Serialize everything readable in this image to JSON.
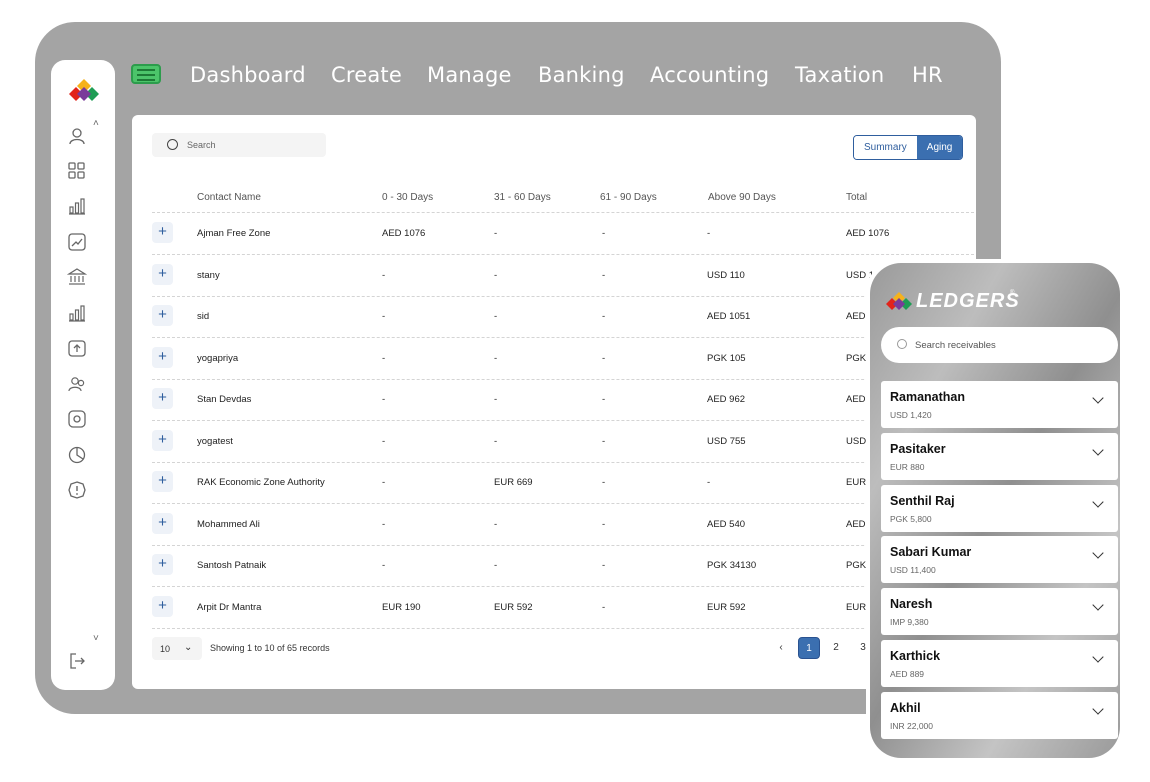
{
  "nav": {
    "items": [
      "Dashboard",
      "Create",
      "Manage",
      "Banking",
      "Accounting",
      "Taxation",
      "HR"
    ]
  },
  "sidebar": {
    "icons": [
      "user-icon",
      "grid-icon",
      "bar-chart-icon",
      "trend-chart-icon",
      "bank-icon",
      "bar-chart-icon",
      "upload-icon",
      "users-icon",
      "settings-icon",
      "pie-chart-icon",
      "alert-icon"
    ],
    "logout_icon": "logout-icon"
  },
  "panel": {
    "search_placeholder": "Search",
    "toggle": {
      "summary": "Summary",
      "aging": "Aging"
    },
    "columns": [
      "Contact Name",
      "0 - 30 Days",
      "31 - 60 Days",
      "61 - 90 Days",
      "Above 90 Days",
      "Total"
    ],
    "rows": [
      {
        "name": "Ajman Free Zone",
        "d0": "AED 1076",
        "d31": "-",
        "d61": "-",
        "d90": "-",
        "total": "AED 1076"
      },
      {
        "name": "stany",
        "d0": "-",
        "d31": "-",
        "d61": "-",
        "d90": "USD 110",
        "total": "USD 1"
      },
      {
        "name": "sid",
        "d0": "-",
        "d31": "-",
        "d61": "-",
        "d90": "AED 1051",
        "total": "AED"
      },
      {
        "name": "yogapriya",
        "d0": "-",
        "d31": "-",
        "d61": "-",
        "d90": "PGK 105",
        "total": "PGK"
      },
      {
        "name": "Stan Devdas",
        "d0": "-",
        "d31": "-",
        "d61": "-",
        "d90": "AED 962",
        "total": "AED"
      },
      {
        "name": "yogatest",
        "d0": "-",
        "d31": "-",
        "d61": "-",
        "d90": "USD 755",
        "total": "USD"
      },
      {
        "name": "RAK Economic Zone Authority",
        "d0": "-",
        "d31": "EUR 669",
        "d61": "-",
        "d90": "-",
        "total": "EUR"
      },
      {
        "name": "Mohammed Ali",
        "d0": "-",
        "d31": "-",
        "d61": "-",
        "d90": "AED 540",
        "total": "AED"
      },
      {
        "name": "Santosh Patnaik",
        "d0": "-",
        "d31": "-",
        "d61": "-",
        "d90": "PGK 34130",
        "total": "PGK"
      },
      {
        "name": "Arpit Dr Mantra",
        "d0": "EUR 190",
        "d31": "EUR 592",
        "d61": "-",
        "d90": "EUR 592",
        "total": "EUR"
      }
    ],
    "page_size": "10",
    "showing": "Showing 1 to 10 of 65 records",
    "pages": [
      "1",
      "2",
      "3"
    ],
    "prev": "‹"
  },
  "phone": {
    "brand": "LEDGERS",
    "reg": "®",
    "search_placeholder": "Search receivables",
    "cards": [
      {
        "name": "Ramanathan",
        "amount": "USD 1,420"
      },
      {
        "name": "Pasitaker",
        "amount": "EUR 880"
      },
      {
        "name": "Senthil Raj",
        "amount": "PGK 5,800"
      },
      {
        "name": "Sabari Kumar",
        "amount": "USD 11,400"
      },
      {
        "name": "Naresh",
        "amount": "IMP 9,380"
      },
      {
        "name": "Karthick",
        "amount": "AED 889"
      },
      {
        "name": "Akhil",
        "amount": "INR 22,000"
      }
    ]
  },
  "colors": {
    "accent": "#3b6fb0",
    "frame": "#a4a4a4",
    "menu": "#4cc46a"
  }
}
